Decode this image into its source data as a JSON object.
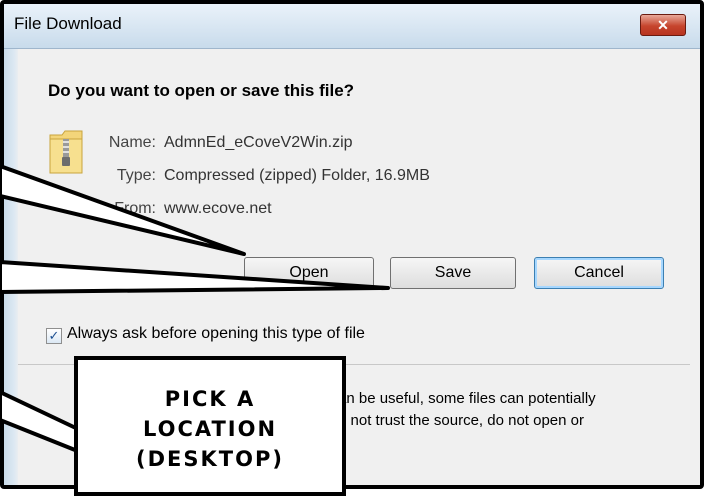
{
  "dialog": {
    "title": "File Download",
    "close_label": "✕",
    "question": "Do you want to open or save this file?",
    "file": {
      "name_label": "Name:",
      "name_value": "AdmnEd_eCoveV2Win.zip",
      "type_label": "Type:",
      "type_value": "Compressed (zipped) Folder, 16.9MB",
      "from_label": "From:",
      "from_value": "www.ecove.net"
    },
    "buttons": {
      "open": "Open",
      "save": "Save",
      "cancel": "Cancel"
    },
    "checkbox": {
      "label": "Always ask before opening this type of file",
      "checked": true,
      "mark": "✓"
    },
    "warning": {
      "line1": "an be useful, some files can potentially",
      "line2": "o not trust the source, do not open or",
      "link_fragment": "?"
    }
  },
  "callout": {
    "lines": [
      "PICK A",
      "LOCATION",
      "(DESKTOP)"
    ]
  },
  "colors": {
    "titlebar": "#c8dbeb",
    "close_button": "#c6452d",
    "default_button_border": "#3c7fb1",
    "link": "#0044cc"
  }
}
